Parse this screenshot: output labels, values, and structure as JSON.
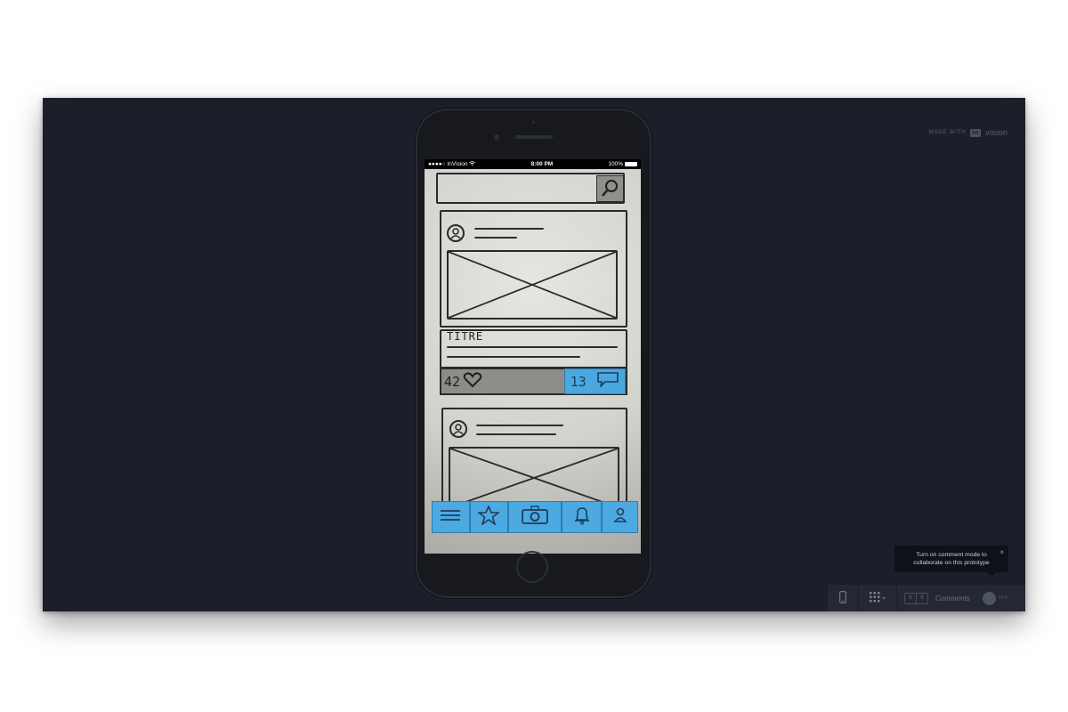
{
  "brand": {
    "made_with": "MADE WITH",
    "logo": "in",
    "word": "vision"
  },
  "phone": {
    "status": {
      "carrier": "●●●●○ InVision",
      "time": "8:00 PM",
      "battery": "100%"
    },
    "sketch": {
      "post_title": "TITRE",
      "likes": "42",
      "comments": "13"
    },
    "tabbar_icons": [
      "menu-icon",
      "star-icon",
      "camera-icon",
      "bell-icon",
      "profile-icon"
    ]
  },
  "tooltip": {
    "text": "Turn on comment mode to collaborate on this prototype",
    "close": "×"
  },
  "toolbar": {
    "counter_left": "0",
    "counter_right": "0",
    "comments_label": "Comments",
    "toggle_label": "OFF"
  },
  "colors": {
    "background": "#1b1f29",
    "sticky": "#4ca9e2",
    "toolbar": "#242833"
  }
}
